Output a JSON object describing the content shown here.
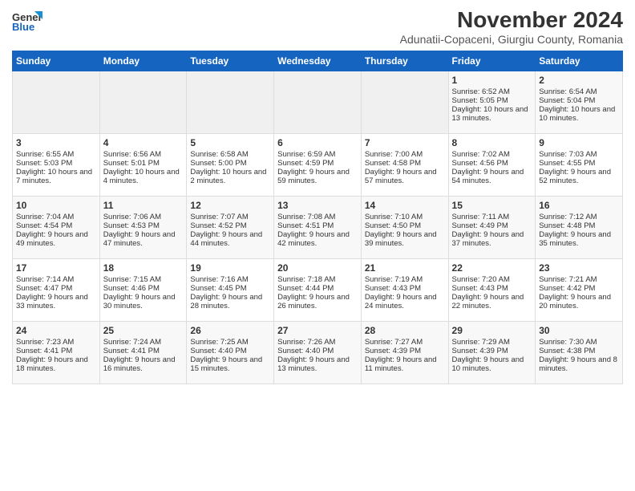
{
  "header": {
    "logo_general": "General",
    "logo_blue": "Blue",
    "month_title": "November 2024",
    "location": "Adunatii-Copaceni, Giurgiu County, Romania"
  },
  "weekdays": [
    "Sunday",
    "Monday",
    "Tuesday",
    "Wednesday",
    "Thursday",
    "Friday",
    "Saturday"
  ],
  "weeks": [
    [
      {
        "day": "",
        "empty": true
      },
      {
        "day": "",
        "empty": true
      },
      {
        "day": "",
        "empty": true
      },
      {
        "day": "",
        "empty": true
      },
      {
        "day": "",
        "empty": true
      },
      {
        "day": "1",
        "sunrise": "Sunrise: 6:52 AM",
        "sunset": "Sunset: 5:05 PM",
        "daylight": "Daylight: 10 hours and 13 minutes."
      },
      {
        "day": "2",
        "sunrise": "Sunrise: 6:54 AM",
        "sunset": "Sunset: 5:04 PM",
        "daylight": "Daylight: 10 hours and 10 minutes."
      }
    ],
    [
      {
        "day": "3",
        "sunrise": "Sunrise: 6:55 AM",
        "sunset": "Sunset: 5:03 PM",
        "daylight": "Daylight: 10 hours and 7 minutes."
      },
      {
        "day": "4",
        "sunrise": "Sunrise: 6:56 AM",
        "sunset": "Sunset: 5:01 PM",
        "daylight": "Daylight: 10 hours and 4 minutes."
      },
      {
        "day": "5",
        "sunrise": "Sunrise: 6:58 AM",
        "sunset": "Sunset: 5:00 PM",
        "daylight": "Daylight: 10 hours and 2 minutes."
      },
      {
        "day": "6",
        "sunrise": "Sunrise: 6:59 AM",
        "sunset": "Sunset: 4:59 PM",
        "daylight": "Daylight: 9 hours and 59 minutes."
      },
      {
        "day": "7",
        "sunrise": "Sunrise: 7:00 AM",
        "sunset": "Sunset: 4:58 PM",
        "daylight": "Daylight: 9 hours and 57 minutes."
      },
      {
        "day": "8",
        "sunrise": "Sunrise: 7:02 AM",
        "sunset": "Sunset: 4:56 PM",
        "daylight": "Daylight: 9 hours and 54 minutes."
      },
      {
        "day": "9",
        "sunrise": "Sunrise: 7:03 AM",
        "sunset": "Sunset: 4:55 PM",
        "daylight": "Daylight: 9 hours and 52 minutes."
      }
    ],
    [
      {
        "day": "10",
        "sunrise": "Sunrise: 7:04 AM",
        "sunset": "Sunset: 4:54 PM",
        "daylight": "Daylight: 9 hours and 49 minutes."
      },
      {
        "day": "11",
        "sunrise": "Sunrise: 7:06 AM",
        "sunset": "Sunset: 4:53 PM",
        "daylight": "Daylight: 9 hours and 47 minutes."
      },
      {
        "day": "12",
        "sunrise": "Sunrise: 7:07 AM",
        "sunset": "Sunset: 4:52 PM",
        "daylight": "Daylight: 9 hours and 44 minutes."
      },
      {
        "day": "13",
        "sunrise": "Sunrise: 7:08 AM",
        "sunset": "Sunset: 4:51 PM",
        "daylight": "Daylight: 9 hours and 42 minutes."
      },
      {
        "day": "14",
        "sunrise": "Sunrise: 7:10 AM",
        "sunset": "Sunset: 4:50 PM",
        "daylight": "Daylight: 9 hours and 39 minutes."
      },
      {
        "day": "15",
        "sunrise": "Sunrise: 7:11 AM",
        "sunset": "Sunset: 4:49 PM",
        "daylight": "Daylight: 9 hours and 37 minutes."
      },
      {
        "day": "16",
        "sunrise": "Sunrise: 7:12 AM",
        "sunset": "Sunset: 4:48 PM",
        "daylight": "Daylight: 9 hours and 35 minutes."
      }
    ],
    [
      {
        "day": "17",
        "sunrise": "Sunrise: 7:14 AM",
        "sunset": "Sunset: 4:47 PM",
        "daylight": "Daylight: 9 hours and 33 minutes."
      },
      {
        "day": "18",
        "sunrise": "Sunrise: 7:15 AM",
        "sunset": "Sunset: 4:46 PM",
        "daylight": "Daylight: 9 hours and 30 minutes."
      },
      {
        "day": "19",
        "sunrise": "Sunrise: 7:16 AM",
        "sunset": "Sunset: 4:45 PM",
        "daylight": "Daylight: 9 hours and 28 minutes."
      },
      {
        "day": "20",
        "sunrise": "Sunrise: 7:18 AM",
        "sunset": "Sunset: 4:44 PM",
        "daylight": "Daylight: 9 hours and 26 minutes."
      },
      {
        "day": "21",
        "sunrise": "Sunrise: 7:19 AM",
        "sunset": "Sunset: 4:43 PM",
        "daylight": "Daylight: 9 hours and 24 minutes."
      },
      {
        "day": "22",
        "sunrise": "Sunrise: 7:20 AM",
        "sunset": "Sunset: 4:43 PM",
        "daylight": "Daylight: 9 hours and 22 minutes."
      },
      {
        "day": "23",
        "sunrise": "Sunrise: 7:21 AM",
        "sunset": "Sunset: 4:42 PM",
        "daylight": "Daylight: 9 hours and 20 minutes."
      }
    ],
    [
      {
        "day": "24",
        "sunrise": "Sunrise: 7:23 AM",
        "sunset": "Sunset: 4:41 PM",
        "daylight": "Daylight: 9 hours and 18 minutes."
      },
      {
        "day": "25",
        "sunrise": "Sunrise: 7:24 AM",
        "sunset": "Sunset: 4:41 PM",
        "daylight": "Daylight: 9 hours and 16 minutes."
      },
      {
        "day": "26",
        "sunrise": "Sunrise: 7:25 AM",
        "sunset": "Sunset: 4:40 PM",
        "daylight": "Daylight: 9 hours and 15 minutes."
      },
      {
        "day": "27",
        "sunrise": "Sunrise: 7:26 AM",
        "sunset": "Sunset: 4:40 PM",
        "daylight": "Daylight: 9 hours and 13 minutes."
      },
      {
        "day": "28",
        "sunrise": "Sunrise: 7:27 AM",
        "sunset": "Sunset: 4:39 PM",
        "daylight": "Daylight: 9 hours and 11 minutes."
      },
      {
        "day": "29",
        "sunrise": "Sunrise: 7:29 AM",
        "sunset": "Sunset: 4:39 PM",
        "daylight": "Daylight: 9 hours and 10 minutes."
      },
      {
        "day": "30",
        "sunrise": "Sunrise: 7:30 AM",
        "sunset": "Sunset: 4:38 PM",
        "daylight": "Daylight: 9 hours and 8 minutes."
      }
    ]
  ]
}
